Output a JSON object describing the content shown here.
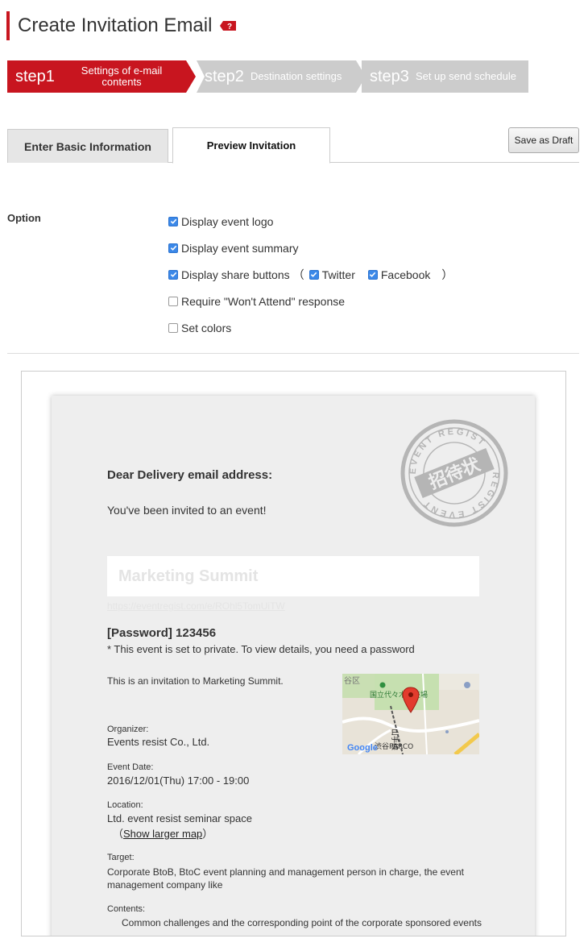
{
  "header": {
    "title": "Create Invitation Email"
  },
  "steps": [
    {
      "num": "step1",
      "label": "Settings of e-mail contents",
      "active": true
    },
    {
      "num": "step2",
      "label": "Destination settings",
      "active": false
    },
    {
      "num": "step3",
      "label": "Set up send schedule",
      "active": false
    }
  ],
  "tabs": {
    "basic": "Enter Basic Information",
    "preview": "Preview Invitation"
  },
  "toolbar": {
    "save_draft": "Save as Draft"
  },
  "options": {
    "label": "Option",
    "display_logo": "Display event logo",
    "display_summary": "Display event summary",
    "display_share": "Display share buttons",
    "paren_open": "（",
    "twitter": "Twitter",
    "facebook": "Facebook",
    "paren_close": "）",
    "require_wont_attend": "Require \"Won't Attend\" response",
    "set_colors": "Set colors"
  },
  "email": {
    "greeting": "Dear Delivery email address:",
    "invited": "You've been invited to an event!",
    "event_name": "Marketing Summit",
    "event_url": "https://eventregist.com/e/ROhl5TomUiTW",
    "password": "[Password] 123456",
    "private_note": "* This event is set to private. To view details, you need a password",
    "intro": "This is an invitation to Marketing Summit.",
    "organizer_label": "Organizer:",
    "organizer": "Events resist Co., Ltd.",
    "date_label": "Event Date:",
    "date": "2016/12/01(Thu) 17:00 - 19:00",
    "location_label": "Location:",
    "location": "Ltd. event resist seminar space",
    "map_link_open": "（",
    "map_link": "Show larger map",
    "map_link_close": "）",
    "target_label": "Target:",
    "target": "Corporate BtoB, BtoC event planning and management person in charge, the event management company like",
    "contents_label": "Contents:",
    "contents": "Common challenges and the corresponding point of the corporate sponsored events"
  },
  "stamp": {
    "center": "招待状",
    "ring_top": "EVENT REGIST",
    "ring_bottom": "REGIST EVENT"
  },
  "map": {
    "label_1": "国立代々木競技場",
    "label_2": "渋谷PARCO",
    "label_3": "山手線",
    "label_4": "谷区",
    "brand": "Google"
  },
  "colors": {
    "brand_red": "#c8151f",
    "step_inactive": "#cccccc",
    "checkbox_on": "#3b88e8",
    "card_bg": "#eeeeee"
  }
}
